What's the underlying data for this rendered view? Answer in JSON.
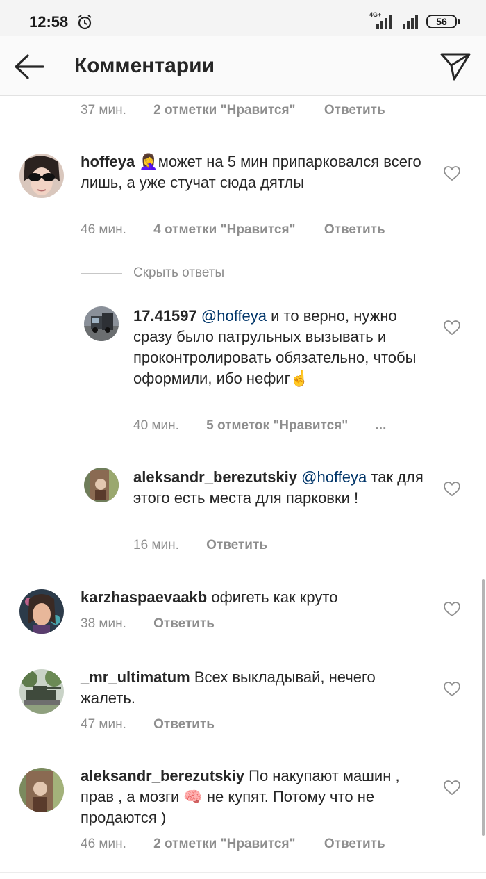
{
  "status": {
    "time": "12:58",
    "network": "4G+",
    "battery": "56"
  },
  "header": {
    "title": "Комментарии",
    "back_icon": "arrow-left-icon",
    "send_icon": "paper-plane-icon"
  },
  "top_meta": {
    "time": "37 мин.",
    "likes": "2 отметки \"Нравится\"",
    "reply": "Ответить"
  },
  "comments": [
    {
      "user": "hoffeya",
      "text": " 🤦‍♀️может на 5 мин припарковался всего лишь, а уже стучат сюда дятлы",
      "time": "46 мин.",
      "likes": "4 отметки \"Нравится\"",
      "reply": "Ответить"
    },
    {
      "user": "karzhaspaevaakb",
      "text": " офигеть как круто",
      "time": "38 мин.",
      "reply": "Ответить"
    },
    {
      "user": "_mr_ultimatum",
      "text": " Всех выкладывай, нечего жалеть.",
      "time": "47 мин.",
      "reply": "Ответить"
    },
    {
      "user": "aleksandr_berezutskiy",
      "text": " По накупают машин , прав , а мозги 🧠 не купят. Потому что не продаются )",
      "time": "46 мин.",
      "likes": "2 отметки \"Нравится\"",
      "reply": "Ответить"
    }
  ],
  "hide_replies": "Скрыть ответы",
  "replies": [
    {
      "user": "17.41597",
      "mention": "@hoffeya",
      "text": " и то верно, нужно сразу было патрульных вызывать и проконтролировать обязательно, чтобы оформили, ибо нефиг☝️",
      "time": "40 мин.",
      "likes": "5 отметок \"Нравится\"",
      "more": "..."
    },
    {
      "user": "aleksandr_berezutskiy",
      "mention": "@hoffeya",
      "text": " так для этого есть места для парковки !",
      "time": "16 мин.",
      "reply": "Ответить"
    }
  ],
  "colors": {
    "mention": "#003569",
    "meta": "#8e8e8e",
    "text": "#262626"
  }
}
